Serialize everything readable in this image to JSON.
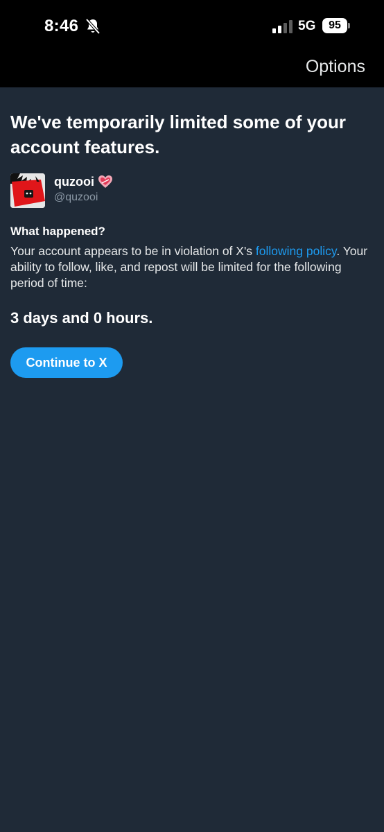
{
  "status_bar": {
    "time": "8:46",
    "network": "5G",
    "battery": "95"
  },
  "header": {
    "options_label": "Options"
  },
  "notice": {
    "headline": "We've temporarily limited some of your account features.",
    "user": {
      "display_name": "quzooi",
      "handle": "@quzooi",
      "badge_icon": "heart-icon"
    },
    "section_title": "What happened?",
    "body_before_link": "Your account appears to be in violation of X's ",
    "link_text": "following policy",
    "body_after_link": ". Your ability to follow, like, and repost will be limited for the following period of time:",
    "duration": "3 days and 0 hours.",
    "button_label": "Continue to X"
  },
  "colors": {
    "background": "#1f2a37",
    "accent": "#1d9bf0",
    "secondary_text": "#8b98a5"
  }
}
